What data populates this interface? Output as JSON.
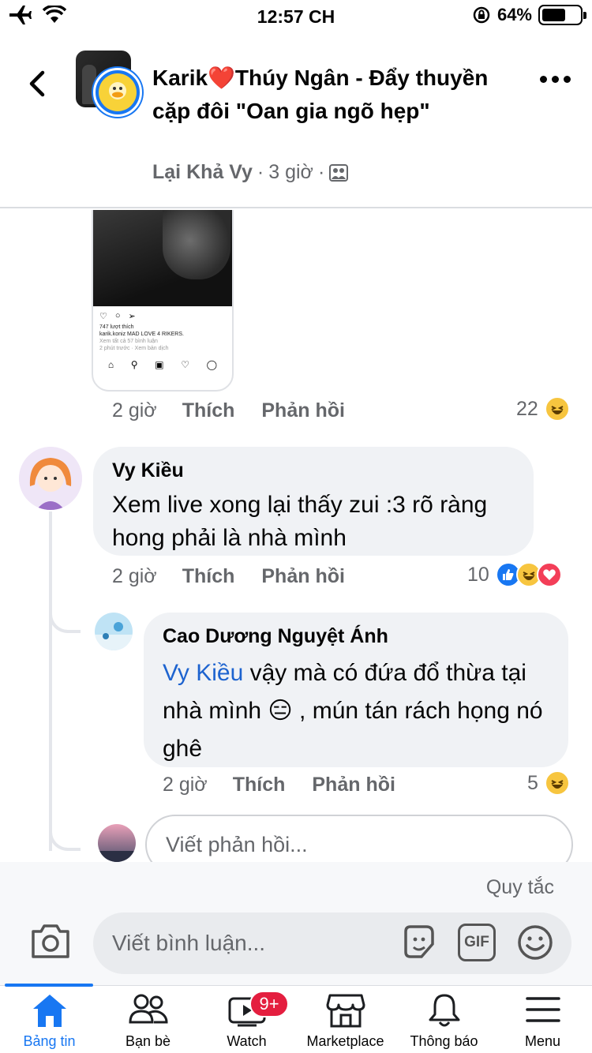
{
  "status_bar": {
    "time": "12:57 CH",
    "battery_text": "64%",
    "battery_level": 0.64,
    "icons": [
      "airplane-icon",
      "wifi-icon",
      "rotation-lock-icon",
      "battery-icon"
    ]
  },
  "header": {
    "title": "Karik❤️Thúy Ngân - Đẩy thuyền cặp đôi \"Oan gia ngõ hẹp\"",
    "author": "Lại Khả Vy",
    "time": "3 giờ",
    "separator": "·"
  },
  "screenshot_thumb": {
    "likes": "747 lượt thích",
    "caption": "karik.koniz MAD LOVE 4 RIKERS.",
    "view_comments": "Xem tất cả 57 bình luận",
    "meta": "2 phút trước · Xem bản dịch"
  },
  "top_comment_actions": {
    "time": "2 giờ",
    "like": "Thích",
    "reply": "Phản hồi",
    "reaction_count": "22"
  },
  "comments": [
    {
      "name": "Vy Kiều",
      "text": "Xem live xong lại thấy zui :3 rõ ràng hong phải là nhà mình",
      "time": "2 giờ",
      "like": "Thích",
      "reply": "Phản hồi",
      "reaction_count": "10"
    },
    {
      "name": "Cao Dương Nguyệt Ánh",
      "mention": "Vy Kiều",
      "text_part1": " vậy mà có đứa đổ thừa tại nhà mình ",
      "emoji": "😑",
      "text_part2": " , mún tán rách họng nó ghê",
      "time": "2 giờ",
      "like": "Thích",
      "reply": "Phản hồi",
      "reaction_count": "5"
    }
  ],
  "reply_input": {
    "placeholder": "Viết phản hồi..."
  },
  "composer": {
    "rules": "Quy tắc",
    "placeholder": "Viết bình luận...",
    "gif": "GIF"
  },
  "tabs": [
    {
      "label": "Bảng tin",
      "icon": "home-icon",
      "active": true
    },
    {
      "label": "Bạn bè",
      "icon": "friends-icon"
    },
    {
      "label": "Watch",
      "icon": "watch-icon",
      "badge": "9+"
    },
    {
      "label": "Marketplace",
      "icon": "marketplace-icon"
    },
    {
      "label": "Thông báo",
      "icon": "bell-icon"
    },
    {
      "label": "Menu",
      "icon": "menu-icon"
    }
  ],
  "colors": {
    "accent": "#1877f2",
    "badge": "#e41e3f",
    "bubble": "#f0f2f5",
    "secondary_text": "#65676b",
    "mention": "#1d63cf"
  }
}
